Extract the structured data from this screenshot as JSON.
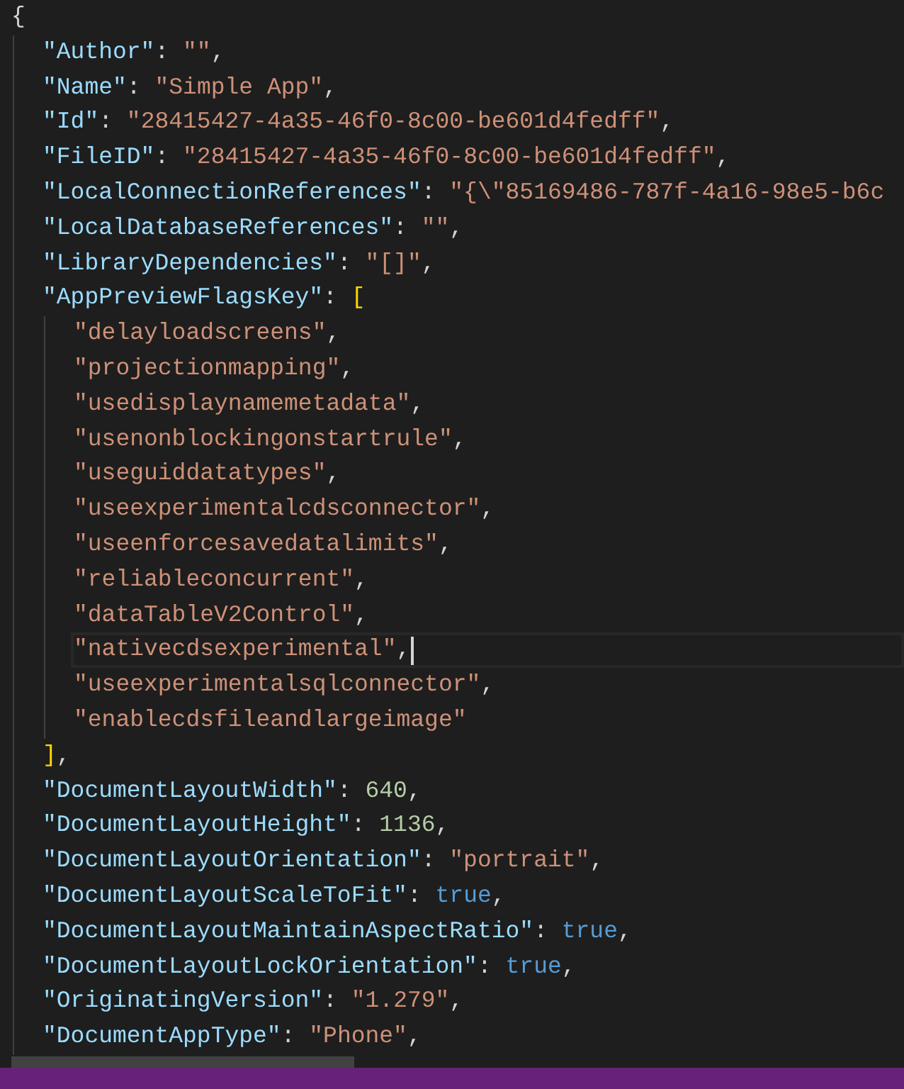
{
  "editor": {
    "lines": [
      {
        "current": false,
        "tokens": [
          {
            "kind": "punct",
            "text": "{"
          }
        ],
        "children": [
          {
            "current": false,
            "tokens": [
              {
                "kind": "key",
                "text": "\"Author\""
              },
              {
                "kind": "punct",
                "text": ": "
              },
              {
                "kind": "string",
                "text": "\"\""
              },
              {
                "kind": "punct",
                "text": ","
              }
            ]
          },
          {
            "current": false,
            "tokens": [
              {
                "kind": "key",
                "text": "\"Name\""
              },
              {
                "kind": "punct",
                "text": ": "
              },
              {
                "kind": "string",
                "text": "\"Simple App\""
              },
              {
                "kind": "punct",
                "text": ","
              }
            ]
          },
          {
            "current": false,
            "tokens": [
              {
                "kind": "key",
                "text": "\"Id\""
              },
              {
                "kind": "punct",
                "text": ": "
              },
              {
                "kind": "string",
                "text": "\"28415427-4a35-46f0-8c00-be601d4fedff\""
              },
              {
                "kind": "punct",
                "text": ","
              }
            ]
          },
          {
            "current": false,
            "tokens": [
              {
                "kind": "key",
                "text": "\"FileID\""
              },
              {
                "kind": "punct",
                "text": ": "
              },
              {
                "kind": "string",
                "text": "\"28415427-4a35-46f0-8c00-be601d4fedff\""
              },
              {
                "kind": "punct",
                "text": ","
              }
            ]
          },
          {
            "current": false,
            "tokens": [
              {
                "kind": "key",
                "text": "\"LocalConnectionReferences\""
              },
              {
                "kind": "punct",
                "text": ": "
              },
              {
                "kind": "string",
                "text": "\"{\\\"85169486-787f-4a16-98e5-b6c"
              }
            ]
          },
          {
            "current": false,
            "tokens": [
              {
                "kind": "key",
                "text": "\"LocalDatabaseReferences\""
              },
              {
                "kind": "punct",
                "text": ": "
              },
              {
                "kind": "string",
                "text": "\"\""
              },
              {
                "kind": "punct",
                "text": ","
              }
            ]
          },
          {
            "current": false,
            "tokens": [
              {
                "kind": "key",
                "text": "\"LibraryDependencies\""
              },
              {
                "kind": "punct",
                "text": ": "
              },
              {
                "kind": "string",
                "text": "\"[]\""
              },
              {
                "kind": "punct",
                "text": ","
              }
            ]
          },
          {
            "current": false,
            "tokens": [
              {
                "kind": "key",
                "text": "\"AppPreviewFlagsKey\""
              },
              {
                "kind": "punct",
                "text": ": "
              },
              {
                "kind": "bracket",
                "text": "["
              }
            ],
            "children": [
              {
                "current": false,
                "tokens": [
                  {
                    "kind": "string",
                    "text": "\"delayloadscreens\""
                  },
                  {
                    "kind": "punct",
                    "text": ","
                  }
                ]
              },
              {
                "current": false,
                "tokens": [
                  {
                    "kind": "string",
                    "text": "\"projectionmapping\""
                  },
                  {
                    "kind": "punct",
                    "text": ","
                  }
                ]
              },
              {
                "current": false,
                "tokens": [
                  {
                    "kind": "string",
                    "text": "\"usedisplaynamemetadata\""
                  },
                  {
                    "kind": "punct",
                    "text": ","
                  }
                ]
              },
              {
                "current": false,
                "tokens": [
                  {
                    "kind": "string",
                    "text": "\"usenonblockingonstartrule\""
                  },
                  {
                    "kind": "punct",
                    "text": ","
                  }
                ]
              },
              {
                "current": false,
                "tokens": [
                  {
                    "kind": "string",
                    "text": "\"useguiddatatypes\""
                  },
                  {
                    "kind": "punct",
                    "text": ","
                  }
                ]
              },
              {
                "current": false,
                "tokens": [
                  {
                    "kind": "string",
                    "text": "\"useexperimentalcdsconnector\""
                  },
                  {
                    "kind": "punct",
                    "text": ","
                  }
                ]
              },
              {
                "current": false,
                "tokens": [
                  {
                    "kind": "string",
                    "text": "\"useenforcesavedatalimits\""
                  },
                  {
                    "kind": "punct",
                    "text": ","
                  }
                ]
              },
              {
                "current": false,
                "tokens": [
                  {
                    "kind": "string",
                    "text": "\"reliableconcurrent\""
                  },
                  {
                    "kind": "punct",
                    "text": ","
                  }
                ]
              },
              {
                "current": false,
                "tokens": [
                  {
                    "kind": "string",
                    "text": "\"dataTableV2Control\""
                  },
                  {
                    "kind": "punct",
                    "text": ","
                  }
                ]
              },
              {
                "current": true,
                "tokens": [
                  {
                    "kind": "string",
                    "text": "\"nativecdsexperimental\""
                  },
                  {
                    "kind": "punct",
                    "text": ","
                  }
                ]
              },
              {
                "current": false,
                "tokens": [
                  {
                    "kind": "string",
                    "text": "\"useexperimentalsqlconnector\""
                  },
                  {
                    "kind": "punct",
                    "text": ","
                  }
                ]
              },
              {
                "current": false,
                "tokens": [
                  {
                    "kind": "string",
                    "text": "\"enablecdsfileandlargeimage\""
                  }
                ]
              }
            ]
          },
          {
            "current": false,
            "tokens": [
              {
                "kind": "bracket",
                "text": "]"
              },
              {
                "kind": "punct",
                "text": ","
              }
            ]
          },
          {
            "current": false,
            "tokens": [
              {
                "kind": "key",
                "text": "\"DocumentLayoutWidth\""
              },
              {
                "kind": "punct",
                "text": ": "
              },
              {
                "kind": "number",
                "text": "640"
              },
              {
                "kind": "punct",
                "text": ","
              }
            ]
          },
          {
            "current": false,
            "tokens": [
              {
                "kind": "key",
                "text": "\"DocumentLayoutHeight\""
              },
              {
                "kind": "punct",
                "text": ": "
              },
              {
                "kind": "number",
                "text": "1136"
              },
              {
                "kind": "punct",
                "text": ","
              }
            ]
          },
          {
            "current": false,
            "tokens": [
              {
                "kind": "key",
                "text": "\"DocumentLayoutOrientation\""
              },
              {
                "kind": "punct",
                "text": ": "
              },
              {
                "kind": "string",
                "text": "\"portrait\""
              },
              {
                "kind": "punct",
                "text": ","
              }
            ]
          },
          {
            "current": false,
            "tokens": [
              {
                "kind": "key",
                "text": "\"DocumentLayoutScaleToFit\""
              },
              {
                "kind": "punct",
                "text": ": "
              },
              {
                "kind": "boolean",
                "text": "true"
              },
              {
                "kind": "punct",
                "text": ","
              }
            ]
          },
          {
            "current": false,
            "tokens": [
              {
                "kind": "key",
                "text": "\"DocumentLayoutMaintainAspectRatio\""
              },
              {
                "kind": "punct",
                "text": ": "
              },
              {
                "kind": "boolean",
                "text": "true"
              },
              {
                "kind": "punct",
                "text": ","
              }
            ]
          },
          {
            "current": false,
            "tokens": [
              {
                "kind": "key",
                "text": "\"DocumentLayoutLockOrientation\""
              },
              {
                "kind": "punct",
                "text": ": "
              },
              {
                "kind": "boolean",
                "text": "true"
              },
              {
                "kind": "punct",
                "text": ","
              }
            ]
          },
          {
            "current": false,
            "tokens": [
              {
                "kind": "key",
                "text": "\"OriginatingVersion\""
              },
              {
                "kind": "punct",
                "text": ": "
              },
              {
                "kind": "string",
                "text": "\"1.279\""
              },
              {
                "kind": "punct",
                "text": ","
              }
            ]
          },
          {
            "current": false,
            "tokens": [
              {
                "kind": "key",
                "text": "\"DocumentAppType\""
              },
              {
                "kind": "punct",
                "text": ": "
              },
              {
                "kind": "string",
                "text": "\"Phone\""
              },
              {
                "kind": "punct",
                "text": ","
              }
            ]
          }
        ]
      }
    ]
  }
}
